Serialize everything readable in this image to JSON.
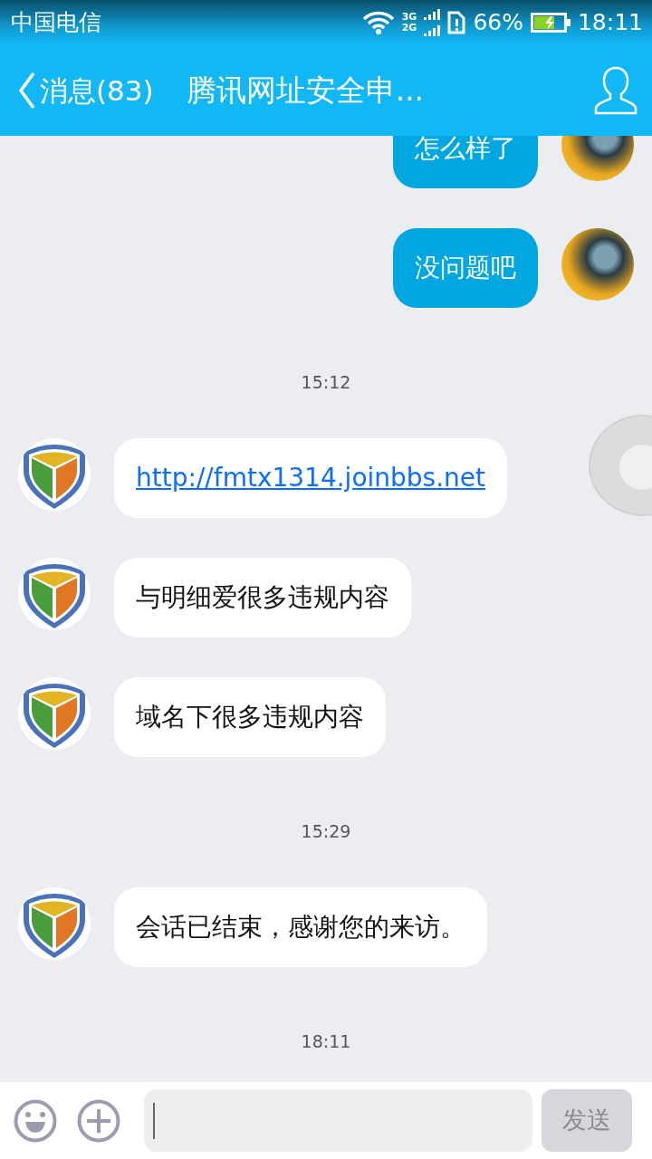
{
  "status_bar": {
    "carrier": "中国电信",
    "network_top": "3G",
    "network_bottom": "2G",
    "battery": "66%",
    "time": "18:11"
  },
  "header": {
    "back_label": "消息(83)",
    "title": "腾讯网址安全申..."
  },
  "messages": [
    {
      "kind": "outgoing",
      "text": "怎么样了",
      "link": false
    },
    {
      "kind": "outgoing",
      "text": "没问题吧",
      "link": false
    },
    {
      "kind": "time",
      "text": "15:12"
    },
    {
      "kind": "incoming",
      "text": "http://fmtx1314.joinbbs.net",
      "link": true
    },
    {
      "kind": "incoming",
      "text": "与明细爱很多违规内容",
      "link": false
    },
    {
      "kind": "incoming",
      "text": "域名下很多违规内容",
      "link": false
    },
    {
      "kind": "time",
      "text": "15:29"
    },
    {
      "kind": "incoming",
      "text": "会话已结束，感谢您的来访。",
      "link": false
    },
    {
      "kind": "time",
      "text": "18:11"
    }
  ],
  "composer": {
    "send_label": "发送",
    "send_disabled": true
  }
}
